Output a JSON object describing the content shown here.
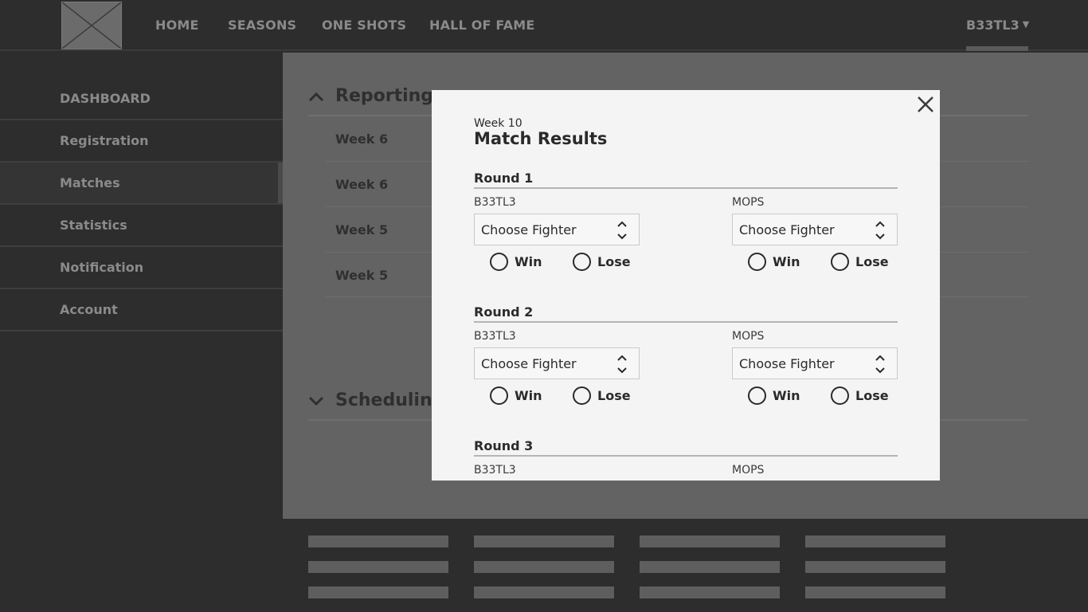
{
  "nav": {
    "items": [
      "HOME",
      "SEASONS",
      "ONE SHOTS",
      "HALL OF FAME"
    ],
    "user": "B33TL3",
    "user_caret": "▼"
  },
  "sidebar": {
    "items": [
      {
        "label": "DASHBOARD"
      },
      {
        "label": "Registration"
      },
      {
        "label": "Matches"
      },
      {
        "label": "Statistics"
      },
      {
        "label": "Notification"
      },
      {
        "label": "Account"
      }
    ]
  },
  "main": {
    "reporting_title": "Reporting",
    "weeks": [
      "Week 6",
      "Week 6",
      "Week 5",
      "Week 5"
    ],
    "scheduling_title": "Scheduling"
  },
  "modal": {
    "week": "Week 10",
    "title": "Match Results",
    "rounds": [
      {
        "title": "Round 1",
        "player_a": "B33TL3",
        "player_b": "MOPS",
        "select_a": "Choose Fighter",
        "select_b": "Choose Fighter",
        "win": "Win",
        "lose": "Lose"
      },
      {
        "title": "Round 2",
        "player_a": "B33TL3",
        "player_b": "MOPS",
        "select_a": "Choose Fighter",
        "select_b": "Choose Fighter",
        "win": "Win",
        "lose": "Lose"
      },
      {
        "title": "Round 3",
        "player_a": "B33TL3",
        "player_b": "MOPS"
      }
    ]
  },
  "colors": {
    "modal_bg": "#f4f4f4",
    "overlay": "#636363",
    "page_bg": "#2d2d2d"
  }
}
